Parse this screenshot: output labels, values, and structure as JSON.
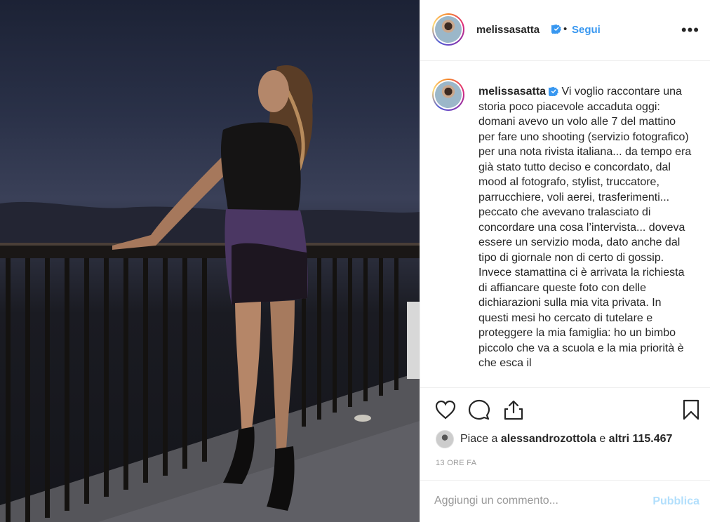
{
  "post": {
    "username": "melissasatta",
    "follow_label": "Segui",
    "separator": "•",
    "more_label": "•••",
    "caption": "Vi voglio raccontare una storia poco piacevole accaduta oggi: domani avevo un volo alle 7 del mattino per fare uno shooting (servizio fotografico) per una nota rivista italiana... da tempo era già stato tutto deciso e concordato, dal mood al fotografo, stylist, truccatore, parrucchiere, voli aerei, trasferimenti... peccato che avevano tralasciato di concordare una cosa l’intervista... doveva essere un servizio moda, dato anche dal tipo di giornale non di certo di gossip. Invece stamattina ci è arrivata la richiesta di affiancare queste foto con delle dichiarazioni sulla mia vita privata. In questi mesi ho cercato di tutelare e proteggere la mia famiglia: ho un bimbo piccolo che va a scuola e la mia priorità è che esca il",
    "likes": {
      "prefix": "Piace a",
      "liker": "alessandrozottola",
      "conjunction": "e",
      "others": "altri 115.467"
    },
    "time": "13 ORE FA"
  },
  "actions": {
    "like_icon": "heart-icon",
    "comment_icon": "comment-icon",
    "share_icon": "share-icon",
    "save_icon": "bookmark-icon"
  },
  "comment_bar": {
    "placeholder": "Aggiungi un commento...",
    "publish_label": "Pubblica"
  },
  "colors": {
    "accent": "#3897f0",
    "publish_disabled": "#b2dffc",
    "verified": "#3897f0",
    "text": "#262626",
    "muted": "#999999"
  }
}
